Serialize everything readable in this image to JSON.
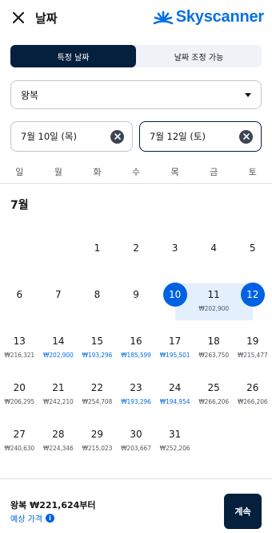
{
  "header": {
    "title": "날짜",
    "brand": "Skyscanner"
  },
  "tabs": [
    {
      "label": "특정 날짜",
      "active": true
    },
    {
      "label": "날짜 조정 가능",
      "active": false
    }
  ],
  "trip_type": {
    "value": "왕복"
  },
  "dates": {
    "depart": "7월 10일 (목)",
    "return": "7월 12일 (토)"
  },
  "weekdays": [
    "일",
    "월",
    "화",
    "수",
    "목",
    "금",
    "토"
  ],
  "month_label": "7월",
  "weeks": [
    [
      null,
      null,
      {
        "d": "1",
        "p": ""
      },
      {
        "d": "2",
        "p": ""
      },
      {
        "d": "3",
        "p": ""
      },
      {
        "d": "4",
        "p": ""
      },
      {
        "d": "5",
        "p": ""
      }
    ],
    [
      {
        "d": "6",
        "p": ""
      },
      {
        "d": "7",
        "p": ""
      },
      {
        "d": "8",
        "p": ""
      },
      {
        "d": "9",
        "p": ""
      },
      {
        "d": "10",
        "p": "",
        "sel": true
      },
      {
        "d": "11",
        "p": "₩202,900"
      },
      {
        "d": "12",
        "p": "",
        "sel": true
      }
    ],
    [
      {
        "d": "13",
        "p": "₩216,321"
      },
      {
        "d": "14",
        "p": "₩202,900",
        "low": true
      },
      {
        "d": "15",
        "p": "₩193,296",
        "low": true
      },
      {
        "d": "16",
        "p": "₩185,599",
        "low": true
      },
      {
        "d": "17",
        "p": "₩195,501",
        "low": true
      },
      {
        "d": "18",
        "p": "₩263,750"
      },
      {
        "d": "19",
        "p": "₩215,477"
      }
    ],
    [
      {
        "d": "20",
        "p": "₩206,295"
      },
      {
        "d": "21",
        "p": "₩242,210"
      },
      {
        "d": "22",
        "p": "₩254,708"
      },
      {
        "d": "23",
        "p": "₩193,296",
        "low": true
      },
      {
        "d": "24",
        "p": "₩194,954",
        "low": true
      },
      {
        "d": "25",
        "p": "₩266,206"
      },
      {
        "d": "26",
        "p": "₩266,206"
      }
    ],
    [
      {
        "d": "27",
        "p": "₩240,630"
      },
      {
        "d": "28",
        "p": "₩224,346"
      },
      {
        "d": "29",
        "p": "₩215,023"
      },
      {
        "d": "30",
        "p": "₩203,667"
      },
      {
        "d": "31",
        "p": "₩252,206"
      },
      null,
      null
    ]
  ],
  "footer": {
    "price": "왕복 ₩221,624부터",
    "estimate": "예상 가격",
    "info": "i",
    "continue": "계속"
  },
  "colors": {
    "accent": "#0062e3",
    "dark": "#05203c",
    "range_bg": "#e3effd",
    "brand": "#0770e3"
  }
}
